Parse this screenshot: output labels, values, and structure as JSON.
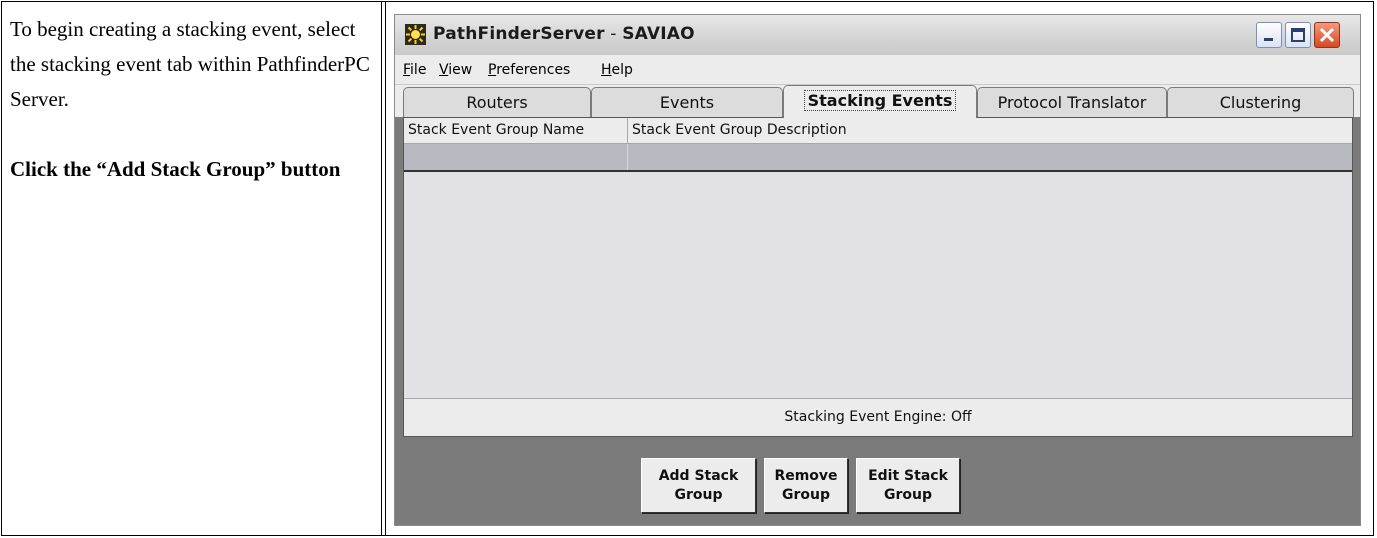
{
  "instructions": {
    "text": "To begin creating a stacking event, select the stacking event tab within PathfinderPC Server.",
    "emphasis": "Click the “Add Stack Group” button"
  },
  "window": {
    "app_name": "PathFinderServer",
    "separator": " - ",
    "host": "SAVIAO",
    "controls": {
      "minimize": "minimize-icon",
      "maximize": "maximize-icon",
      "close": "close-icon"
    }
  },
  "menu": [
    "File",
    "View",
    "Preferences",
    "Help"
  ],
  "tabs": [
    {
      "label": "Routers",
      "active": false
    },
    {
      "label": "Events",
      "active": false
    },
    {
      "label": "Stacking Events",
      "active": true
    },
    {
      "label": "Protocol Translator",
      "active": false
    },
    {
      "label": "Clustering",
      "active": false
    }
  ],
  "grid": {
    "columns": [
      "Stack Event Group Name",
      "Stack Event Group Description"
    ],
    "rows": [
      [
        "",
        ""
      ]
    ]
  },
  "status": "Stacking Event Engine:  Off",
  "buttons": {
    "add": "Add Stack\nGroup",
    "remove": "Remove\nGroup",
    "edit": "Edit Stack\nGroup"
  },
  "colors": {
    "close_button": "#d44a24",
    "panel_background": "#e1e1e6",
    "selected_row": "#b9b9c1",
    "button_area": "#7b7b7b"
  }
}
